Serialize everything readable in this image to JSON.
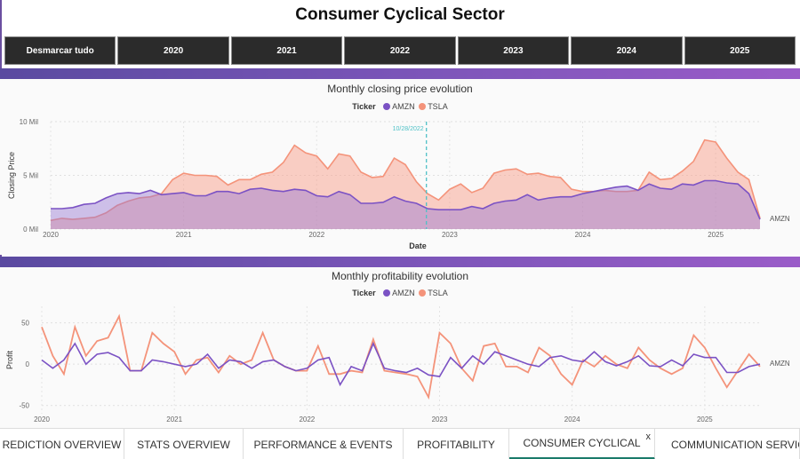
{
  "page": {
    "title": "Consumer Cyclical Sector"
  },
  "filters": [
    "Desmarcar tudo",
    "2020",
    "2021",
    "2022",
    "2023",
    "2024",
    "2025"
  ],
  "tabs": [
    {
      "label": "REDICTION OVERVIEW",
      "active": false
    },
    {
      "label": "STATS OVERVIEW",
      "active": false
    },
    {
      "label": "PERFORMANCE & EVENTS",
      "active": false
    },
    {
      "label": "PROFITABILITY",
      "active": false
    },
    {
      "label": "CONSUMER CYCLICAL",
      "active": true,
      "close": "x"
    },
    {
      "label": "COMMUNICATION SERVICE",
      "active": false
    }
  ],
  "colors": {
    "amzn": "#7b52c4",
    "tsla": "#f4937a",
    "reference": "#4fc1c7"
  },
  "legend": {
    "title": "Ticker",
    "items": [
      "AMZN",
      "TSLA"
    ]
  },
  "chart_data": [
    {
      "type": "area",
      "title": "Monthly closing price evolution",
      "xlabel": "Date",
      "ylabel": "Closing Price",
      "x_ticks": [
        "2020",
        "2021",
        "2022",
        "2023",
        "2024",
        "2025"
      ],
      "y_ticks": [
        "0 Mil",
        "5 Mil",
        "10 Mil"
      ],
      "ylim": [
        0,
        10
      ],
      "unit": "Mil",
      "reference_line": "10/28/2022",
      "end_label": "AMZN",
      "series": [
        {
          "name": "AMZN",
          "values": [
            1.9,
            1.9,
            2.0,
            2.3,
            2.4,
            2.9,
            3.3,
            3.4,
            3.3,
            3.6,
            3.2,
            3.3,
            3.4,
            3.1,
            3.1,
            3.5,
            3.5,
            3.3,
            3.7,
            3.8,
            3.6,
            3.5,
            3.7,
            3.6,
            3.1,
            3.0,
            3.5,
            3.2,
            2.4,
            2.4,
            2.5,
            3.0,
            2.6,
            2.4,
            1.9,
            1.8,
            1.8,
            1.8,
            2.1,
            1.9,
            2.4,
            2.6,
            2.7,
            3.2,
            2.7,
            2.9,
            3.0,
            3.0,
            3.3,
            3.5,
            3.7,
            3.9,
            4.0,
            3.6,
            4.2,
            3.8,
            3.7,
            4.2,
            4.1,
            4.5,
            4.5,
            4.3,
            4.2,
            3.3,
            0.9
          ]
        },
        {
          "name": "TSLA",
          "values": [
            0.8,
            1.0,
            0.9,
            1.0,
            1.1,
            1.5,
            2.2,
            2.6,
            2.9,
            3.0,
            3.3,
            4.6,
            5.2,
            5.0,
            5.0,
            4.9,
            4.1,
            4.6,
            4.6,
            5.1,
            5.3,
            6.2,
            7.8,
            7.1,
            6.8,
            5.6,
            7.0,
            6.8,
            5.3,
            4.8,
            4.9,
            6.6,
            6.0,
            4.4,
            3.3,
            2.7,
            3.7,
            4.2,
            3.4,
            3.8,
            5.2,
            5.5,
            5.6,
            5.1,
            5.2,
            4.9,
            4.8,
            3.7,
            3.5,
            3.5,
            3.6,
            3.5,
            3.5,
            3.6,
            5.3,
            4.6,
            4.7,
            5.4,
            6.3,
            8.3,
            8.1,
            6.6,
            5.3,
            4.6,
            1.0
          ]
        }
      ]
    },
    {
      "type": "line",
      "title": "Monthly profitability evolution",
      "ylabel": "Profit",
      "x_ticks": [
        "2020",
        "2021",
        "2022",
        "2023",
        "2024",
        "2025"
      ],
      "y_ticks": [
        "50",
        "0",
        "-50"
      ],
      "ylim": [
        -60,
        70
      ],
      "end_label": "AMZN",
      "series": [
        {
          "name": "AMZN",
          "values": [
            5,
            -5,
            5,
            25,
            0,
            12,
            14,
            8,
            -8,
            -8,
            5,
            3,
            0,
            -3,
            0,
            12,
            -5,
            5,
            3,
            -5,
            3,
            5,
            -3,
            -8,
            -5,
            5,
            8,
            -25,
            -3,
            -8,
            25,
            -5,
            -8,
            -10,
            -5,
            -13,
            -15,
            8,
            -5,
            10,
            0,
            15,
            10,
            5,
            0,
            -3,
            8,
            10,
            5,
            3,
            15,
            3,
            -2,
            3,
            10,
            -2,
            -3,
            5,
            -2,
            12,
            8,
            8,
            -10,
            -10,
            -3,
            0
          ]
        },
        {
          "name": "TSLA",
          "values": [
            45,
            10,
            -12,
            45,
            10,
            28,
            32,
            58,
            -8,
            -8,
            38,
            25,
            15,
            -12,
            5,
            8,
            -10,
            10,
            0,
            5,
            38,
            5,
            -3,
            -8,
            -8,
            22,
            -12,
            -12,
            -8,
            -10,
            30,
            -8,
            -10,
            -12,
            -15,
            -40,
            38,
            25,
            -5,
            -20,
            22,
            25,
            -3,
            -3,
            -10,
            20,
            10,
            -12,
            -25,
            5,
            -3,
            10,
            0,
            -5,
            20,
            5,
            -5,
            -12,
            -5,
            35,
            20,
            -5,
            -28,
            -8,
            12,
            -3
          ]
        }
      ]
    }
  ]
}
